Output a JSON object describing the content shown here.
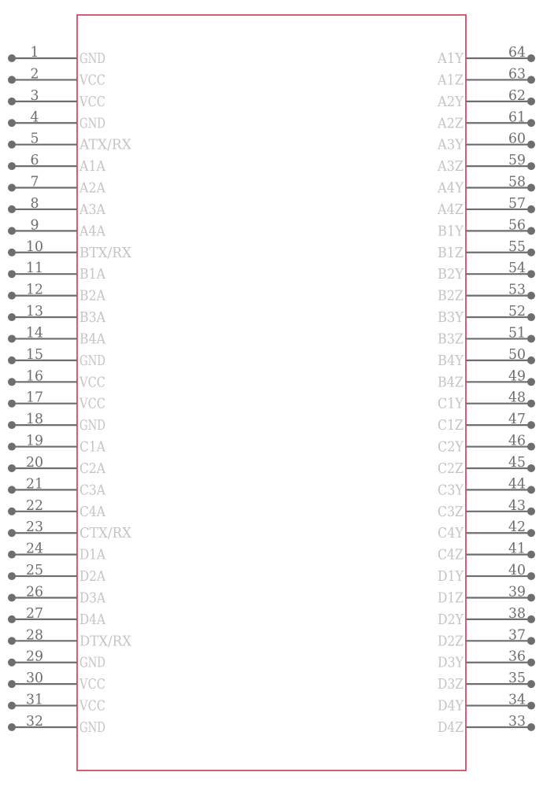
{
  "component": {
    "body_color": "#c8385a",
    "pin_color": "#6e6e6e",
    "label_color": "#c4c4c4",
    "left_pins": [
      {
        "num": "1",
        "name": "GND"
      },
      {
        "num": "2",
        "name": "VCC"
      },
      {
        "num": "3",
        "name": "VCC"
      },
      {
        "num": "4",
        "name": "GND"
      },
      {
        "num": "5",
        "name": "ATX/RX"
      },
      {
        "num": "6",
        "name": "A1A"
      },
      {
        "num": "7",
        "name": "A2A"
      },
      {
        "num": "8",
        "name": "A3A"
      },
      {
        "num": "9",
        "name": "A4A"
      },
      {
        "num": "10",
        "name": "BTX/RX"
      },
      {
        "num": "11",
        "name": "B1A"
      },
      {
        "num": "12",
        "name": "B2A"
      },
      {
        "num": "13",
        "name": "B3A"
      },
      {
        "num": "14",
        "name": "B4A"
      },
      {
        "num": "15",
        "name": "GND"
      },
      {
        "num": "16",
        "name": "VCC"
      },
      {
        "num": "17",
        "name": "VCC"
      },
      {
        "num": "18",
        "name": "GND"
      },
      {
        "num": "19",
        "name": "C1A"
      },
      {
        "num": "20",
        "name": "C2A"
      },
      {
        "num": "21",
        "name": "C3A"
      },
      {
        "num": "22",
        "name": "C4A"
      },
      {
        "num": "23",
        "name": "CTX/RX"
      },
      {
        "num": "24",
        "name": "D1A"
      },
      {
        "num": "25",
        "name": "D2A"
      },
      {
        "num": "26",
        "name": "D3A"
      },
      {
        "num": "27",
        "name": "D4A"
      },
      {
        "num": "28",
        "name": "DTX/RX"
      },
      {
        "num": "29",
        "name": "GND"
      },
      {
        "num": "30",
        "name": "VCC"
      },
      {
        "num": "31",
        "name": "VCC"
      },
      {
        "num": "32",
        "name": "GND"
      }
    ],
    "right_pins": [
      {
        "num": "64",
        "name": "A1Y"
      },
      {
        "num": "63",
        "name": "A1Z"
      },
      {
        "num": "62",
        "name": "A2Y"
      },
      {
        "num": "61",
        "name": "A2Z"
      },
      {
        "num": "60",
        "name": "A3Y"
      },
      {
        "num": "59",
        "name": "A3Z"
      },
      {
        "num": "58",
        "name": "A4Y"
      },
      {
        "num": "57",
        "name": "A4Z"
      },
      {
        "num": "56",
        "name": "B1Y"
      },
      {
        "num": "55",
        "name": "B1Z"
      },
      {
        "num": "54",
        "name": "B2Y"
      },
      {
        "num": "53",
        "name": "B2Z"
      },
      {
        "num": "52",
        "name": "B3Y"
      },
      {
        "num": "51",
        "name": "B3Z"
      },
      {
        "num": "50",
        "name": "B4Y"
      },
      {
        "num": "49",
        "name": "B4Z"
      },
      {
        "num": "48",
        "name": "C1Y"
      },
      {
        "num": "47",
        "name": "C1Z"
      },
      {
        "num": "46",
        "name": "C2Y"
      },
      {
        "num": "45",
        "name": "C2Z"
      },
      {
        "num": "44",
        "name": "C3Y"
      },
      {
        "num": "43",
        "name": "C3Z"
      },
      {
        "num": "42",
        "name": "C4Y"
      },
      {
        "num": "41",
        "name": "C4Z"
      },
      {
        "num": "40",
        "name": "D1Y"
      },
      {
        "num": "39",
        "name": "D1Z"
      },
      {
        "num": "38",
        "name": "D2Y"
      },
      {
        "num": "37",
        "name": "D2Z"
      },
      {
        "num": "36",
        "name": "D3Y"
      },
      {
        "num": "35",
        "name": "D3Z"
      },
      {
        "num": "34",
        "name": "D4Y"
      },
      {
        "num": "33",
        "name": "D4Z"
      }
    ]
  }
}
